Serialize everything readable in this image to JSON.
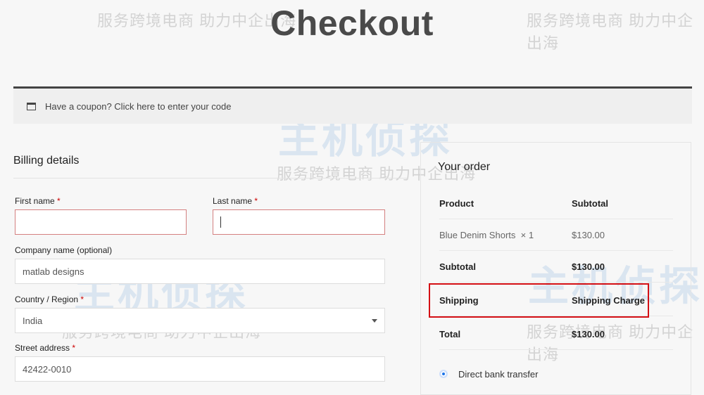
{
  "page_title": "Checkout",
  "coupon": {
    "icon": "window-icon",
    "text": "Have a coupon? Click here to enter your code"
  },
  "billing": {
    "heading": "Billing details",
    "required_mark": "*",
    "first_name": {
      "label": "First name",
      "value": ""
    },
    "last_name": {
      "label": "Last name",
      "value": ""
    },
    "company": {
      "label": "Company name (optional)",
      "value": "matlab designs"
    },
    "country": {
      "label": "Country / Region",
      "value": "India"
    },
    "street": {
      "label": "Street address",
      "value": "42422-0010"
    }
  },
  "order": {
    "heading": "Your order",
    "col_product": "Product",
    "col_subtotal": "Subtotal",
    "item_name": "Blue Denim Shorts",
    "item_qty": "× 1",
    "item_price": "$130.00",
    "subtotal_label": "Subtotal",
    "subtotal_value": "$130.00",
    "shipping_label": "Shipping",
    "shipping_value": "Shipping Charge",
    "total_label": "Total",
    "total_value": "$130.00",
    "payment_method": "Direct bank transfer"
  },
  "watermark": {
    "brand": "主机侦探",
    "slogan": "服务跨境电商 助力中企出海"
  },
  "colors": {
    "highlight": "#d40f14",
    "radio": "#1a73e8"
  }
}
